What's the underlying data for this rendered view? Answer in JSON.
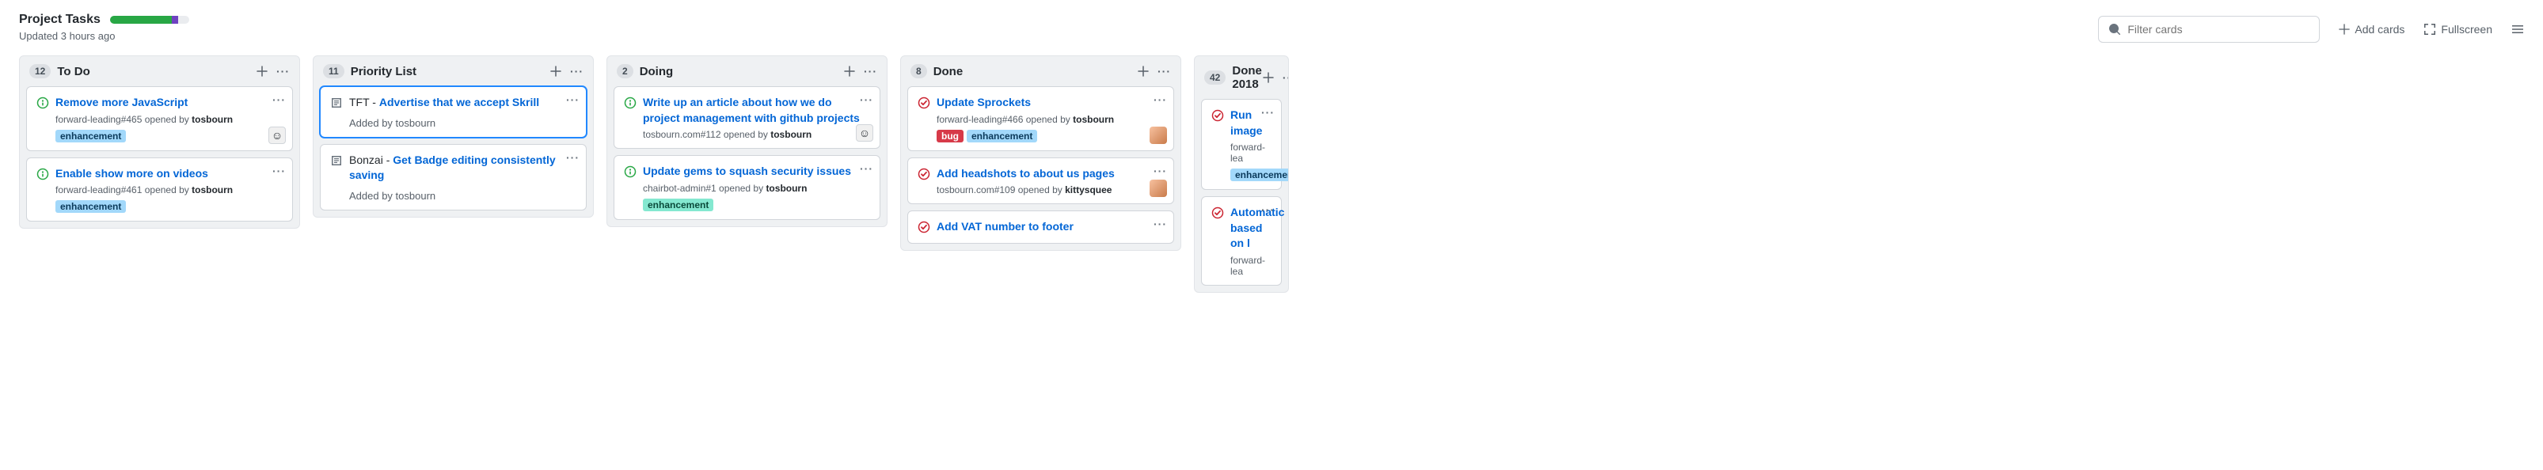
{
  "header": {
    "title": "Project Tasks",
    "updated": "Updated 3 hours ago",
    "progress": {
      "done_pct": 78,
      "progress_pct": 8
    },
    "filter_placeholder": "Filter cards",
    "add_cards": "Add cards",
    "fullscreen": "Fullscreen"
  },
  "labels": {
    "enhancement_blue": {
      "text": "enhancement",
      "bg": "#a2d8fa",
      "fg": "#0b3a5b"
    },
    "enhancement_teal": {
      "text": "enhancement",
      "bg": "#84e8d0",
      "fg": "#0a4a3a"
    },
    "bug": {
      "text": "bug",
      "bg": "#d73a49",
      "fg": "#ffffff"
    }
  },
  "columns": [
    {
      "count": "12",
      "title": "To Do",
      "cards": [
        {
          "type": "issue-open",
          "title": "Remove more JavaScript",
          "meta_repo": "forward-leading#465 opened by ",
          "meta_author": "tosbourn",
          "labels": [
            "enhancement_blue"
          ],
          "avatar": "face"
        },
        {
          "type": "issue-open",
          "title": "Enable show more on videos",
          "meta_repo": "forward-leading#461 opened by ",
          "meta_author": "tosbourn",
          "labels": [
            "enhancement_blue"
          ]
        }
      ]
    },
    {
      "count": "11",
      "title": "Priority List",
      "cards": [
        {
          "type": "note",
          "selected": true,
          "prefix": "TFT - ",
          "title": "Advertise that we accept Skrill",
          "added_by_label": "Added by ",
          "added_by": "tosbourn"
        },
        {
          "type": "note",
          "prefix": "Bonzai - ",
          "title": "Get Badge editing consistently saving",
          "added_by_label": "Added by ",
          "added_by": "tosbourn"
        }
      ]
    },
    {
      "count": "2",
      "title": "Doing",
      "cards": [
        {
          "type": "issue-open",
          "title": "Write up an article about how we do project management with github projects",
          "meta_repo": "tosbourn.com#112 opened by ",
          "meta_author": "tosbourn",
          "avatar": "face"
        },
        {
          "type": "issue-open",
          "title": "Update gems to squash security issues",
          "meta_repo": "chairbot-admin#1 opened by ",
          "meta_author": "tosbourn",
          "labels": [
            "enhancement_teal"
          ]
        }
      ]
    },
    {
      "count": "8",
      "title": "Done",
      "cards": [
        {
          "type": "issue-closed",
          "title": "Update Sprockets",
          "meta_repo": "forward-leading#466 opened by ",
          "meta_author": "tosbourn",
          "labels": [
            "bug",
            "enhancement_blue"
          ],
          "avatar": "photo"
        },
        {
          "type": "issue-closed",
          "title": "Add headshots to about us pages",
          "meta_repo": "tosbourn.com#109 opened by ",
          "meta_author": "kittysquee",
          "avatar": "photo"
        },
        {
          "type": "issue-closed",
          "title": "Add VAT number to footer"
        }
      ]
    },
    {
      "count": "42",
      "title": "Done 2018",
      "truncated": true,
      "cards": [
        {
          "type": "issue-closed",
          "title": "Run image",
          "meta_repo": "forward-lea",
          "labels": [
            "enhancement_blue"
          ],
          "truncated": true
        },
        {
          "type": "issue-closed",
          "title": "Automatic",
          "title2": "based on l",
          "meta_repo": "forward-lea",
          "truncated": true
        }
      ]
    }
  ]
}
